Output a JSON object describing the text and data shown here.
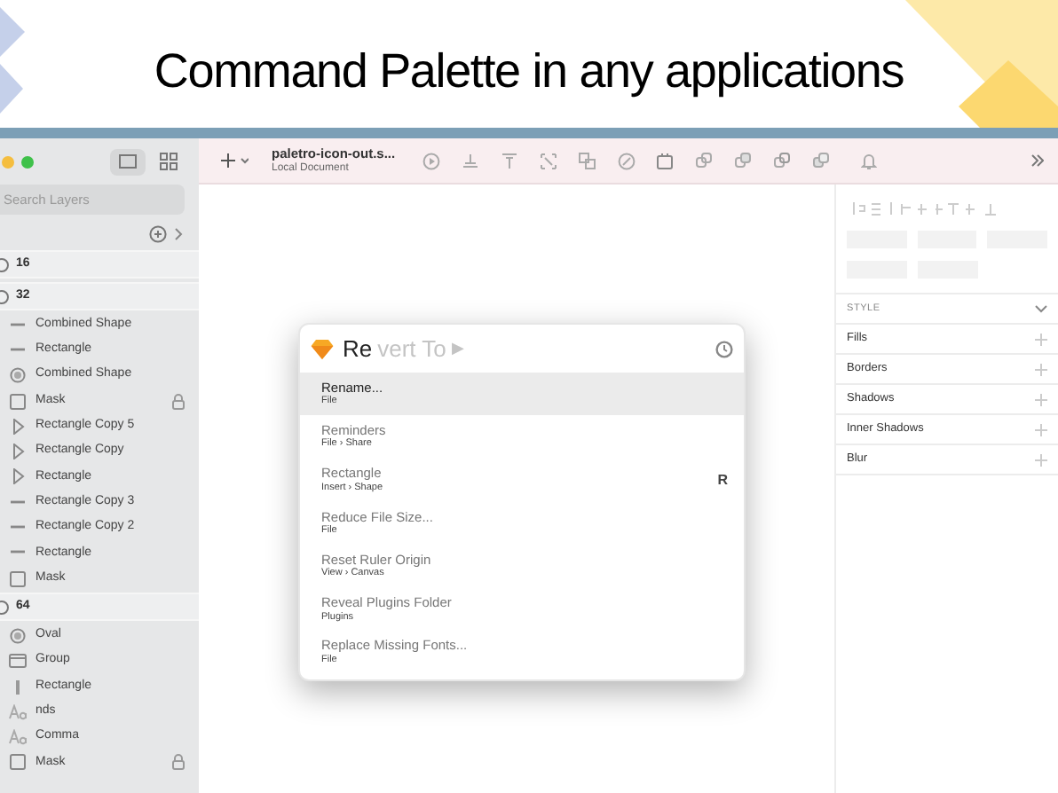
{
  "headline": "Command Palette in any applications",
  "sidebar": {
    "search": {
      "placeholder": "Search Layers"
    },
    "layers": [
      {
        "name": "16",
        "kind": "artboard",
        "locked": false
      },
      {
        "name": "32",
        "kind": "artboard",
        "locked": false
      },
      {
        "name": "Combined Shape",
        "kind": "line",
        "locked": false
      },
      {
        "name": "Rectangle",
        "kind": "line",
        "locked": false
      },
      {
        "name": "Combined Shape",
        "kind": "circle",
        "locked": false
      },
      {
        "name": "Mask",
        "kind": "square",
        "locked": true
      },
      {
        "name": "Rectangle Copy 5",
        "kind": "triangle",
        "locked": false
      },
      {
        "name": "Rectangle Copy",
        "kind": "triangle",
        "locked": false
      },
      {
        "name": "Rectangle",
        "kind": "triangle",
        "locked": false
      },
      {
        "name": "Rectangle Copy 3",
        "kind": "line",
        "locked": false
      },
      {
        "name": "Rectangle Copy 2",
        "kind": "line",
        "locked": false
      },
      {
        "name": "Rectangle",
        "kind": "line",
        "locked": false
      },
      {
        "name": "Mask",
        "kind": "square",
        "locked": false
      },
      {
        "name": "64",
        "kind": "artboard",
        "locked": false
      },
      {
        "name": "Oval",
        "kind": "circle",
        "locked": false
      },
      {
        "name": "Group",
        "kind": "folder",
        "locked": false
      },
      {
        "name": "Rectangle",
        "kind": "bar",
        "locked": false
      },
      {
        "name": "nds",
        "kind": "text",
        "locked": false
      },
      {
        "name": "Comma",
        "kind": "text",
        "locked": false
      },
      {
        "name": "Mask",
        "kind": "square",
        "locked": true
      }
    ]
  },
  "toolbar": {
    "document": "paletro-icon-out.s...",
    "location": "Local Document"
  },
  "inspector": {
    "section": "STYLE",
    "rows": [
      "Fills",
      "Borders",
      "Shadows",
      "Inner Shadows",
      "Blur"
    ]
  },
  "palette": {
    "typed": "Re",
    "completion": "vert To",
    "arrow": "▶",
    "items": [
      {
        "title": "Rename...",
        "path": "File",
        "selected": true
      },
      {
        "title": "Reminders",
        "path": "File › Share",
        "selected": false
      },
      {
        "title": "Rectangle",
        "path": "Insert › Shape",
        "selected": false,
        "shortcut": "R"
      },
      {
        "title": "Reduce File Size...",
        "path": "File",
        "selected": false
      },
      {
        "title": "Reset Ruler Origin",
        "path": "View › Canvas",
        "selected": false
      },
      {
        "title": "Reveal Plugins Folder",
        "path": "Plugins",
        "selected": false
      },
      {
        "title": "Replace Missing Fonts...",
        "path": "File",
        "selected": false
      }
    ]
  }
}
